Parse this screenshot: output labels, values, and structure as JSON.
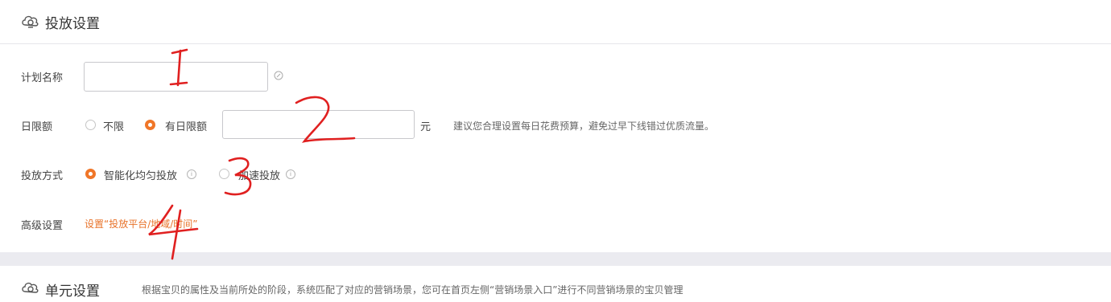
{
  "delivery_section": {
    "title": "投放设置",
    "plan_name": {
      "label": "计划名称",
      "value": "",
      "placeholder": ""
    },
    "daily_budget": {
      "label": "日限额",
      "option_unlimited": "不限",
      "option_limited": "有日限额",
      "selected": "有日限额",
      "value": "",
      "unit": "元",
      "hint": "建议您合理设置每日花费预算，避免过早下线错过优质流量。"
    },
    "delivery_method": {
      "label": "投放方式",
      "option_smooth": "智能化均匀投放",
      "option_fast": "加速投放",
      "selected": "智能化均匀投放"
    },
    "advanced": {
      "label": "高级设置",
      "link": "设置“投放平台/地域/时间”"
    }
  },
  "unit_section": {
    "title": "单元设置",
    "hint": "根据宝贝的属性及当前所处的阶段，系统匹配了对应的营销场景，您可在首页左侧“营销场景入口”进行不同营销场景的宝贝管理"
  },
  "annotations": [
    "1",
    "2",
    "3",
    "4"
  ],
  "colors": {
    "accent": "#f07628",
    "link": "#e8732a",
    "annotation": "#e02020",
    "divider": "#ebebf0"
  },
  "icons": {
    "section_icon": "gear-cloud-icon",
    "info_icon": "info-circle-icon",
    "edit_icon": "edit-icon"
  }
}
